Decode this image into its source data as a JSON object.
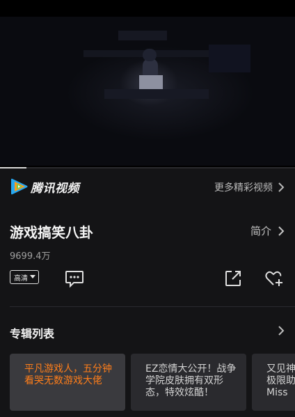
{
  "player": {
    "progress_fraction": 0.09
  },
  "brand": {
    "logo_icon": "tencent-video-logo-icon",
    "name": "腾讯视频",
    "more_label": "更多精彩视频"
  },
  "video_info": {
    "title": "游戏搞笑八卦",
    "intro_label": "简介",
    "view_count": "9699.4万"
  },
  "actions": {
    "quality_label": "高清",
    "comment_icon": "comment-icon",
    "share_icon": "share-icon",
    "favorite_icon": "favorite-add-icon"
  },
  "album": {
    "title": "专辑列表",
    "items": [
      {
        "text": "平凡游戏人，五分钟看哭无数游戏大佬",
        "active": true
      },
      {
        "text": "EZ恋情大公开！战争学院皮肤拥有双形态，特效炫酷！",
        "active": false
      },
      {
        "text": "又见神子极限助Miss",
        "active": false
      }
    ]
  },
  "colors": {
    "accent": "#ff7e1a",
    "background": "#141416"
  }
}
